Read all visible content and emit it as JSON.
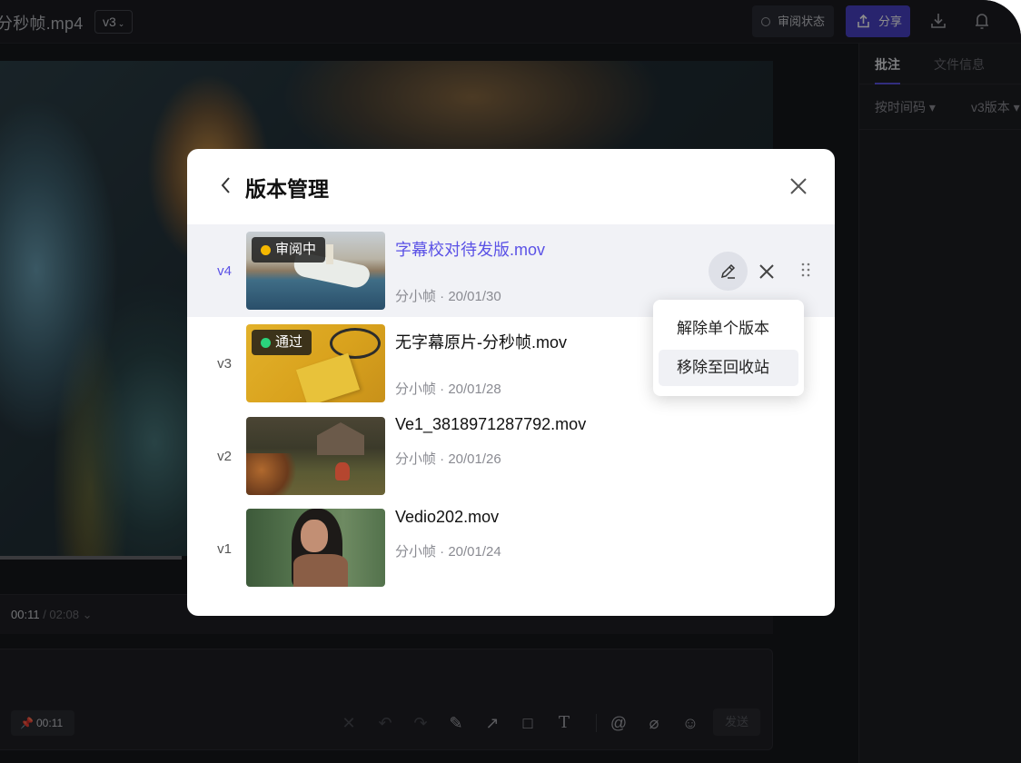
{
  "header": {
    "file_title": "分秒帧.mp4",
    "version_select": "v3",
    "review_status_label": "审阅状态",
    "share_label": "分享"
  },
  "player": {
    "current_time": "00:11",
    "total_time": "/ 02:08"
  },
  "comment": {
    "time_pin": "00:11",
    "send_label": "发送"
  },
  "right_panel": {
    "tabs": [
      "批注",
      "文件信息"
    ],
    "filter_sort": "按时间码",
    "filter_version": "v3版本"
  },
  "modal": {
    "title": "版本管理",
    "versions": [
      {
        "version": "v4",
        "badge": "审阅中",
        "badge_color": "#f5b800",
        "filename": "字幕校对待发版.mov",
        "meta": "分小帧 · 20/01/30"
      },
      {
        "version": "v3",
        "badge": "通过",
        "badge_color": "#2bd47d",
        "filename": "无字幕原片-分秒帧.mov",
        "meta": "分小帧 · 20/01/28"
      },
      {
        "version": "v2",
        "badge": "",
        "filename": "Ve1_3818971287792.mov",
        "meta": "分小帧 · 20/01/26"
      },
      {
        "version": "v1",
        "badge": "",
        "filename": "Vedio202.mov",
        "meta": "分小帧 · 20/01/24"
      }
    ]
  },
  "menu": {
    "items": [
      "解除单个版本",
      "移除至回收站"
    ]
  },
  "colors": {
    "accent": "#5b52e6",
    "share_button": "#4a42c8"
  }
}
